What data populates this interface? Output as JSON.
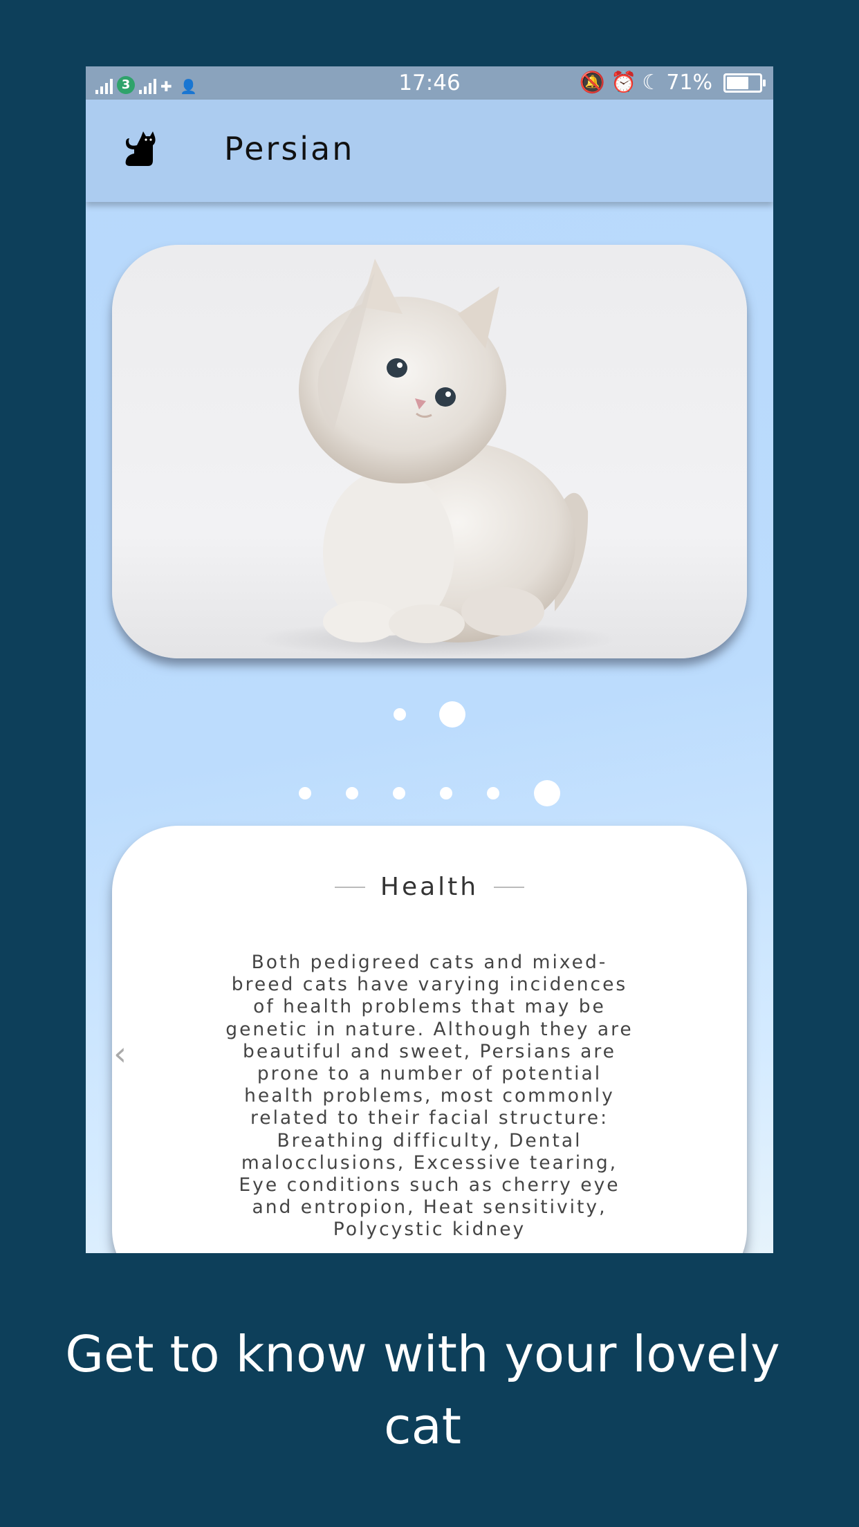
{
  "status_bar": {
    "time": "17:46",
    "battery": "71%",
    "battery_level": 0.71,
    "carrier_badge": "3"
  },
  "app_bar": {
    "title": "Persian",
    "icon": "cat-icon"
  },
  "image_carousel": {
    "page_count": 2,
    "active_index": 1
  },
  "section_pager": {
    "page_count": 6,
    "active_index": 5
  },
  "info_card": {
    "title": "Health",
    "body": "Both pedigreed cats and mixed-breed cats have varying incidences of health problems that may be genetic in nature. Although they are beautiful and sweet, Persians are prone to a number of potential health problems, most commonly related to their facial structure: Breathing difficulty, Dental malocclusions, Excessive tearing, Eye conditions such as cherry eye and entropion, Heat sensitivity, Polycystic kidney"
  },
  "caption": "Get to know with your lovely cat",
  "colors": {
    "page_background": "#0d3f5a",
    "app_bar": "#acccf0",
    "status_bar": "#8aa3bd",
    "screen_background": "#bcdcfd"
  }
}
